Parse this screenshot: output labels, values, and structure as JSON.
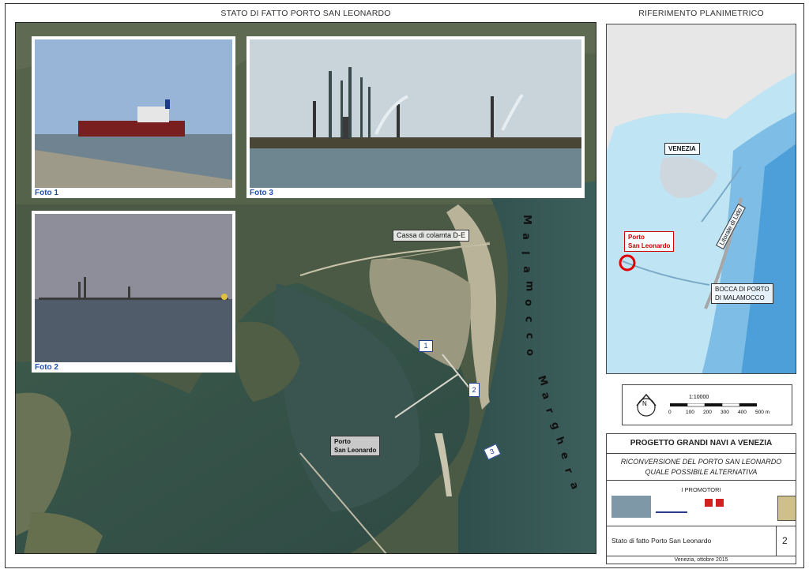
{
  "header": {
    "left_title": "STATO DI FATTO PORTO SAN LEONARDO",
    "right_title": "RIFERIMENTO PLANIMETRICO"
  },
  "photos": [
    {
      "caption": "Foto 1"
    },
    {
      "caption": "Foto 2"
    },
    {
      "caption": "Foto 3"
    }
  ],
  "map_labels": {
    "cassa": "Cassa di colamta D-E",
    "porto": "Porto\nSan Leonardo",
    "canal_letters_1": [
      "M",
      "a",
      "l",
      "a",
      "m",
      "o",
      "c",
      "c",
      "o"
    ],
    "canal_letters_2": [
      "M",
      "a",
      "r",
      "g",
      "h",
      "e",
      "r",
      "a"
    ]
  },
  "markers": [
    "1",
    "2",
    "3"
  ],
  "ref_map": {
    "venezia": "VENEZIA",
    "porto": "Porto\nSan Leonardo",
    "lido": "Litorale di Lido",
    "bocca": "BOCCA DI PORTO\nDI MALAMOCCO",
    "colors": {
      "water": "#b9e3f3",
      "sea": "#5aa9dd",
      "land": "#e8e8e8"
    }
  },
  "scale": {
    "north": "N",
    "ratio": "1:10000",
    "ticks": [
      "0",
      "100",
      "200",
      "300",
      "400",
      "500 m"
    ]
  },
  "title_block": {
    "project": "PROGETTO GRANDI NAVI A VENEZIA",
    "subtitle_line1": "RICONVERSIONE DEL PORTO SAN LEONARDO",
    "subtitle_line2": "QUALE POSSIBILE ALTERNATIVA",
    "promoters_label": "I PROMOTORI",
    "sheet_title": "Stato di fatto Porto San Leonardo",
    "sheet_number": "2",
    "footer": "Venezia, ottobre 2015"
  }
}
